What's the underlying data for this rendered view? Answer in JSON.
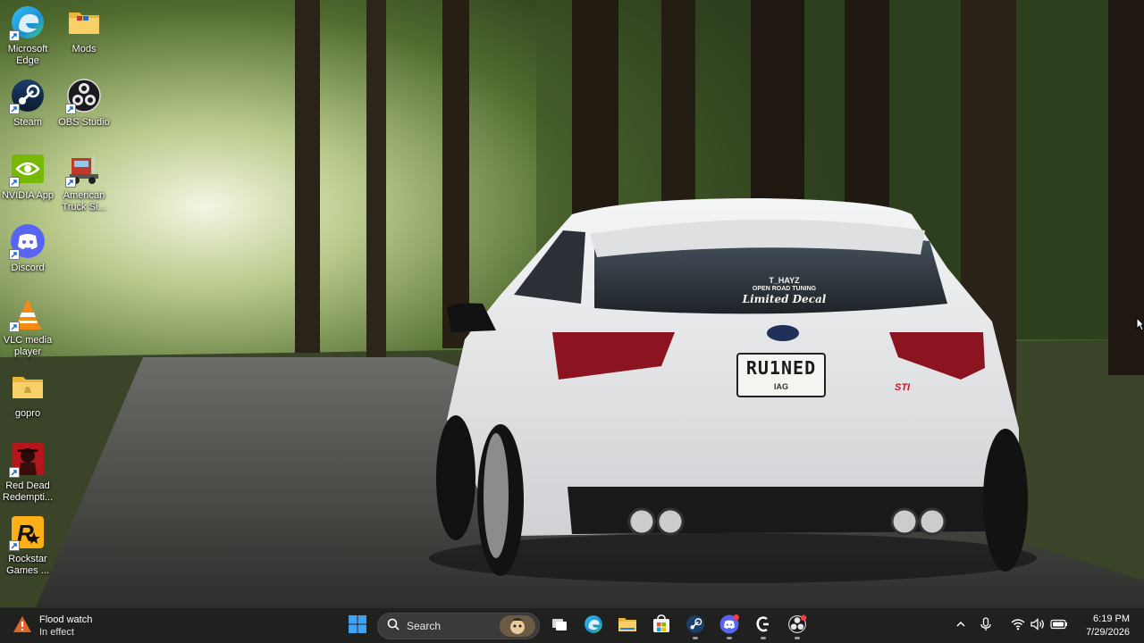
{
  "desktop": {
    "icons": [
      {
        "label": "Microsoft Edge",
        "icon": "edge-icon"
      },
      {
        "label": "Mods",
        "icon": "folder-icon"
      },
      {
        "label": "Steam",
        "icon": "steam-icon"
      },
      {
        "label": "OBS Studio",
        "icon": "obs-icon"
      },
      {
        "label": "NVIDIA App",
        "icon": "nvidia-icon"
      },
      {
        "label": "American Truck Si...",
        "icon": "truck-icon"
      },
      {
        "label": "Discord",
        "icon": "discord-icon"
      },
      {
        "label": "VLC media player",
        "icon": "vlc-icon"
      },
      {
        "label": "gopro",
        "icon": "folder-icon"
      },
      {
        "label": "Red Dead Redempti...",
        "icon": "rdr-icon"
      },
      {
        "label": "Rockstar Games ...",
        "icon": "rockstar-icon"
      }
    ]
  },
  "wallpaper": {
    "plate_text": "RU1NED",
    "plate_sub": "IAG",
    "decal_line1": "T_HAYZ",
    "decal_line2": "OPEN ROAD TUNING",
    "decal_line3": "Limited Decal",
    "badge": "STI"
  },
  "taskbar": {
    "weather": {
      "title": "Flood watch",
      "subtitle": "In effect",
      "icon": "warning-icon"
    },
    "search_placeholder": "Search",
    "pinned": [
      "start-icon",
      "search-icon",
      "task-view-icon",
      "edge-icon",
      "file-explorer-icon",
      "store-icon",
      "steam-icon",
      "discord-icon",
      "app-icon",
      "obs-icon"
    ],
    "tray": [
      "chevron-up-icon",
      "microphone-icon",
      "wifi-icon",
      "speaker-icon",
      "battery-icon"
    ],
    "time": "6:19 PM",
    "date": "7/29/2026"
  },
  "colors": {
    "taskbar_bg": "#202020",
    "windows_blue": "#3fa3f5",
    "discord": "#5865f2",
    "car_white": "#e9eaec"
  }
}
